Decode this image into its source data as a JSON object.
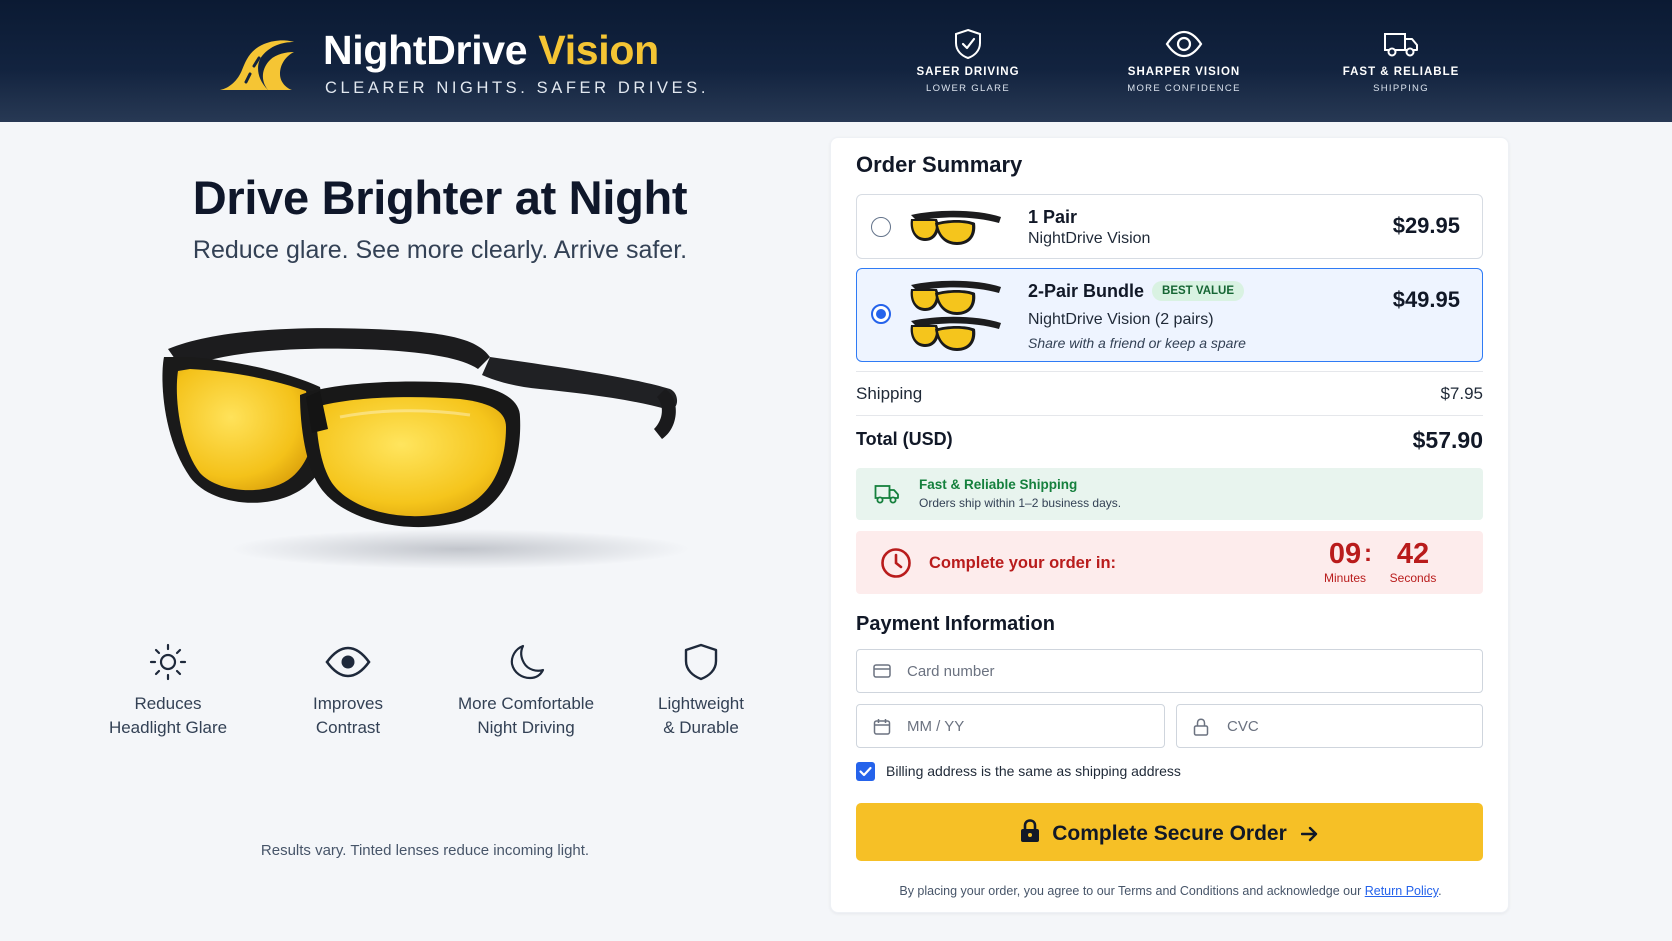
{
  "header": {
    "brand_main": "NightDrive",
    "brand_accent": "Vision",
    "tagline": "CLEARER NIGHTS. SAFER DRIVES.",
    "features": [
      {
        "icon": "shield-check-icon",
        "title": "SAFER DRIVING",
        "subtitle": "LOWER GLARE"
      },
      {
        "icon": "eye-icon",
        "title": "SHARPER VISION",
        "subtitle": "MORE CONFIDENCE"
      },
      {
        "icon": "truck-icon",
        "title": "FAST & RELIABLE",
        "subtitle": "SHIPPING"
      }
    ]
  },
  "hero": {
    "title": "Drive Brighter at Night",
    "subtitle": "Reduce glare. See more clearly. Arrive safer.",
    "features": [
      {
        "icon": "sun-icon",
        "line1": "Reduces",
        "line2": "Headlight Glare"
      },
      {
        "icon": "eye-icon",
        "line1": "Improves",
        "line2": "Contrast"
      },
      {
        "icon": "moon-icon",
        "line1": "More Comfortable",
        "line2": "Night Driving"
      },
      {
        "icon": "shield-icon",
        "line1": "Lightweight",
        "line2": "& Durable"
      }
    ],
    "disclaimer": "Results vary. Tinted lenses reduce incoming light."
  },
  "order": {
    "title": "Order Summary",
    "options": [
      {
        "name": "1 Pair",
        "desc": "NightDrive Vision",
        "price": "$29.95",
        "selected": false
      },
      {
        "name": "2-Pair Bundle",
        "badge": "BEST VALUE",
        "desc": "NightDrive Vision (2 pairs)",
        "note": "Share with a friend or keep a spare",
        "price": "$49.95",
        "selected": true
      }
    ],
    "shipping_label": "Shipping",
    "shipping_value": "$7.95",
    "total_label": "Total (USD)",
    "total_value": "$57.90",
    "ship_notice_title": "Fast & Reliable Shipping",
    "ship_notice_text": "Orders ship within 1–2 business days.",
    "timer_message": "Complete your order in:",
    "timer_minutes": "09",
    "timer_sep": ":",
    "timer_seconds": "42",
    "timer_minutes_label": "Minutes",
    "timer_seconds_label": "Seconds"
  },
  "payment": {
    "title": "Payment Information",
    "card_placeholder": "Card number",
    "expiry_placeholder": "MM / YY",
    "cvc_placeholder": "CVC",
    "billing_same_label": "Billing address is the same as shipping address",
    "billing_same_checked": true,
    "submit_label": "Complete Secure Order",
    "terms_prefix": "By placing your order, you agree to our Terms and Conditions and acknowledge our",
    "terms_link": "Return Policy",
    "terms_suffix": "."
  },
  "colors": {
    "accent_yellow": "#f6c026",
    "selected_blue": "#2563eb",
    "success_green": "#15803d",
    "alert_red": "#b91c1c",
    "header_navy": "#0b1a33"
  }
}
